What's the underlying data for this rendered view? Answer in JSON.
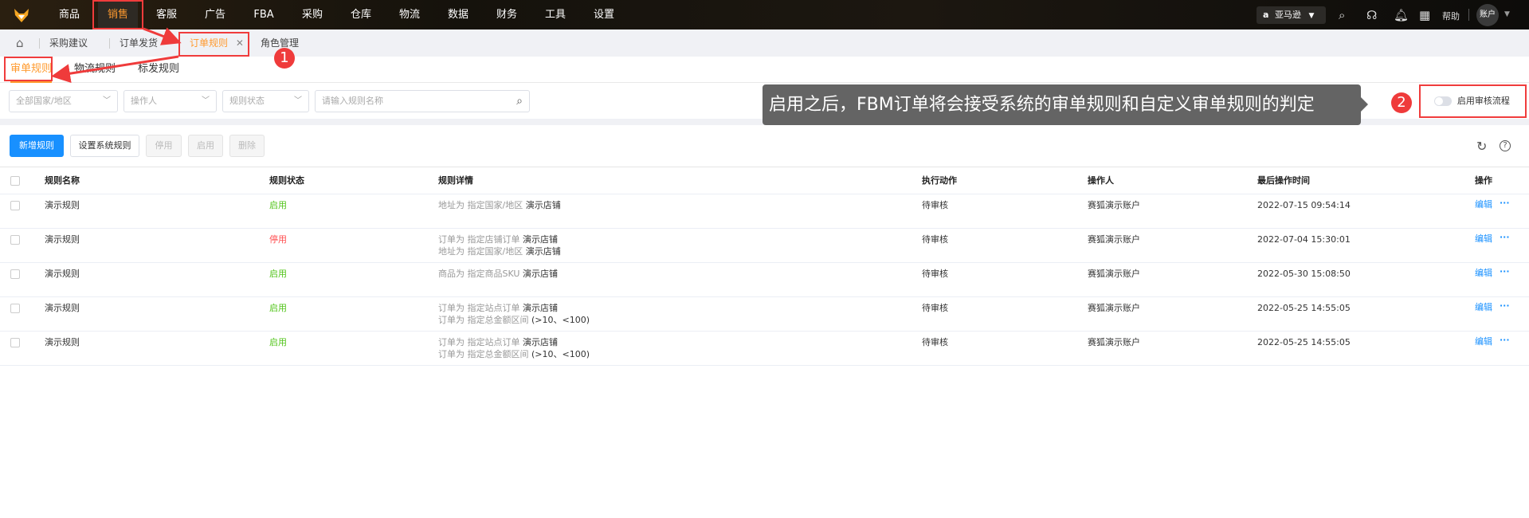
{
  "nav": {
    "items": [
      "商品",
      "销售",
      "客服",
      "广告",
      "FBA",
      "采购",
      "仓库",
      "物流",
      "数据",
      "财务",
      "工具",
      "设置"
    ],
    "active_index": 1,
    "marketplace": "亚马逊",
    "help": "帮助",
    "account": "账户"
  },
  "tabs": {
    "items": [
      "采购建议",
      "订单发货",
      "订单规则",
      "角色管理"
    ],
    "active_index": 2
  },
  "subtabs": {
    "items": [
      "审单规则",
      "物流规则",
      "标发规则"
    ],
    "active_index": 0
  },
  "filters": {
    "country": "全部国家/地区",
    "operator": "操作人",
    "status": "规则状态",
    "search_placeholder": "请输入规则名称"
  },
  "annotations": {
    "badge1": "1",
    "badge2": "2",
    "tooltip": "启用之后，FBM订单将会接受系统的审单规则和自定义审单规则的判定"
  },
  "toggle": {
    "label": "启用审核流程",
    "enabled": false
  },
  "toolbar": {
    "add": "新增规则",
    "system": "设置系统规则",
    "disable": "停用",
    "enable": "启用",
    "delete": "删除"
  },
  "table": {
    "headers": [
      "规则名称",
      "规则状态",
      "规则详情",
      "执行动作",
      "操作人",
      "最后操作时间",
      "操作"
    ],
    "rows": [
      {
        "name": "演示规则",
        "status": "启用",
        "active": true,
        "details": [
          {
            "label": "地址为 指定国家/地区",
            "value": "演示店铺"
          }
        ],
        "action": "待审核",
        "operator": "赛狐演示账户",
        "time": "2022-07-15 09:54:14",
        "edit": "编辑",
        "more": "···"
      },
      {
        "name": "演示规则",
        "status": "停用",
        "active": false,
        "details": [
          {
            "label": "订单为 指定店铺订单",
            "value": "演示店铺"
          },
          {
            "label": "地址为 指定国家/地区",
            "value": "演示店铺"
          }
        ],
        "action": "待审核",
        "operator": "赛狐演示账户",
        "time": "2022-07-04 15:30:01",
        "edit": "编辑",
        "more": "···"
      },
      {
        "name": "演示规则",
        "status": "启用",
        "active": true,
        "details": [
          {
            "label": "商品为 指定商品SKU",
            "value": "演示店铺"
          }
        ],
        "action": "待审核",
        "operator": "赛狐演示账户",
        "time": "2022-05-30 15:08:50",
        "edit": "编辑",
        "more": "···"
      },
      {
        "name": "演示规则",
        "status": "启用",
        "active": true,
        "details": [
          {
            "label": "订单为 指定站点订单",
            "value": "演示店铺"
          },
          {
            "label": "订单为 指定总金额区间",
            "value": "(>10、<100)"
          }
        ],
        "action": "待审核",
        "operator": "赛狐演示账户",
        "time": "2022-05-25 14:55:05",
        "edit": "编辑",
        "more": "···"
      },
      {
        "name": "演示规则",
        "status": "启用",
        "active": true,
        "details": [
          {
            "label": "订单为 指定站点订单",
            "value": "演示店铺"
          },
          {
            "label": "订单为 指定总金额区间",
            "value": "(>10、<100)"
          }
        ],
        "action": "待审核",
        "operator": "赛狐演示账户",
        "time": "2022-05-25 14:55:05",
        "edit": "编辑",
        "more": "···"
      }
    ]
  },
  "colors": {
    "accent": "#ff9a2e",
    "primary": "#1890ff",
    "annotation_red": "#ef3b3b",
    "enabled": "#52c41a",
    "disabled": "#ff4d4f"
  }
}
